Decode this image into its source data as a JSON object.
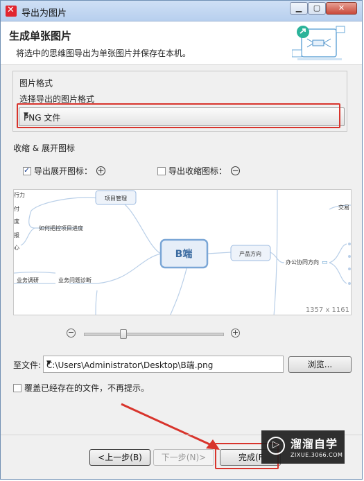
{
  "window": {
    "title": "导出为图片"
  },
  "header": {
    "title": "生成单张图片",
    "description": "将选中的思维图导出为单张图片并保存在本机。"
  },
  "format": {
    "group_label": "图片格式",
    "select_label": "选择导出的图片格式",
    "selected": "PNG 文件"
  },
  "icons_section": {
    "label": "收缩 & 展开图标",
    "expand_label": "导出展开图标：",
    "expand_checked": true,
    "collapse_label": "导出收缩图标：",
    "collapse_checked": false
  },
  "preview": {
    "dimensions": "1357 x 1161",
    "mindmap": {
      "center": "B端",
      "nodes": {
        "project_mgmt": "项目管理",
        "product_dir": "产品方向",
        "office_collab": "办公协同方向",
        "trade": "交易",
        "control_progress": "如何把控项目进度",
        "business_research": "业务调研",
        "business_diagnosis": "业务问题诊断",
        "fragment_1": "行力",
        "fragment_2": "付",
        "fragment_3": "度",
        "fragment_4": "报",
        "fragment_5": "心"
      }
    }
  },
  "zoom": {
    "minus": "−",
    "plus": "+",
    "level": 0.27
  },
  "file": {
    "label": "至文件:",
    "path": "C:\\Users\\Administrator\\Desktop\\B端.png",
    "browse_label": "浏览..."
  },
  "overwrite": {
    "label": "覆盖已经存在的文件，不再提示。",
    "checked": false
  },
  "buttons": {
    "prev": "<上一步(B)",
    "next": "下一步(N)>",
    "finish": "完成(F"
  },
  "watermark": {
    "title": "溜溜自学",
    "subtitle": "ZIXUE.3066.COM"
  },
  "colors": {
    "highlight_red": "#d8342c",
    "node_blue": "#7aa6d6",
    "node_fill": "#e6eef8"
  }
}
